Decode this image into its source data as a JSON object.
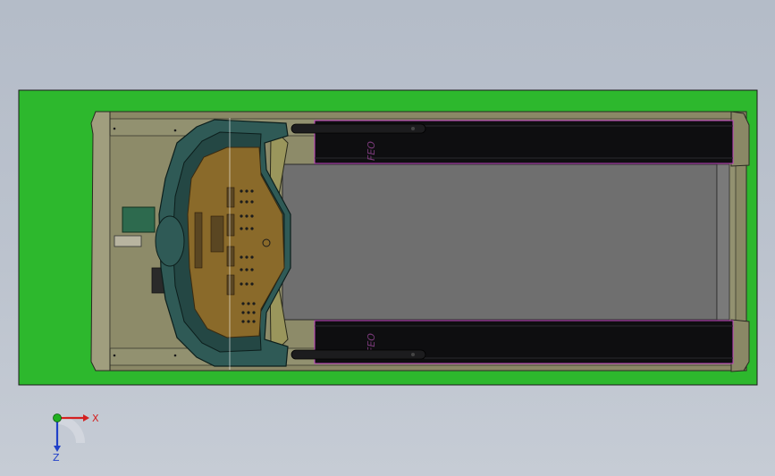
{
  "app": {
    "view": "Top",
    "scene": "treadmill-assembly"
  },
  "colors": {
    "background_top": "#b4bcc8",
    "background_bottom": "#c6ccd5",
    "base_plate": "#2db82d",
    "frame": "#8a8866",
    "frame_inner": "#908f6c",
    "belt": "#6f6f6f",
    "side_rail": "#0e0e10",
    "console_shell": "#2f5a56",
    "console_panel": "#8a6a2a",
    "motor": "#2d6a4e",
    "accent_magenta": "#c040c0"
  },
  "triad": {
    "x_label": "X",
    "z_label": "Z",
    "x_color": "#d42020",
    "y_color": "#20b020",
    "z_color": "#2040c8"
  },
  "rail_labels": {
    "top": "FEO",
    "bottom": "FEO"
  }
}
